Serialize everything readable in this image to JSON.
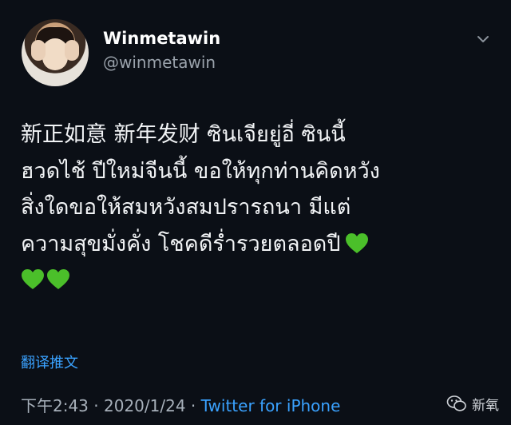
{
  "tweet": {
    "author_name": "Winmetawin",
    "author_handle": "@winmetawin",
    "text_lines": [
      "新正如意 新年发财 ซินเจียยู่อี่ ซินนี้",
      "ฮวดไช้ ปีใหม่จีนนี้ ขอให้ทุกท่านคิดหวัง",
      "สิ่งใดขอให้สมหวังสมปรารถนา มีแต่",
      "ความสุขมั่งคั่ง โชคดีร่ำรวยตลอดปี",
      ""
    ],
    "hearts": {
      "line4": 1,
      "line5": 2,
      "color": "#4bbf2a"
    },
    "translate_label": "翻译推文",
    "time": "下午2:43",
    "date": "2020/1/24",
    "source": "Twitter for iPhone",
    "separator": "·",
    "icons": {
      "menu": "chevron-down-icon",
      "avatar": "profile-photo"
    }
  },
  "watermark": {
    "label": "新氧",
    "icon": "wechat-logo"
  },
  "colors": {
    "background": "#0b0f16",
    "link": "#3aa2ff",
    "text": "#f1f3f5",
    "muted": "#a7b0ba"
  }
}
